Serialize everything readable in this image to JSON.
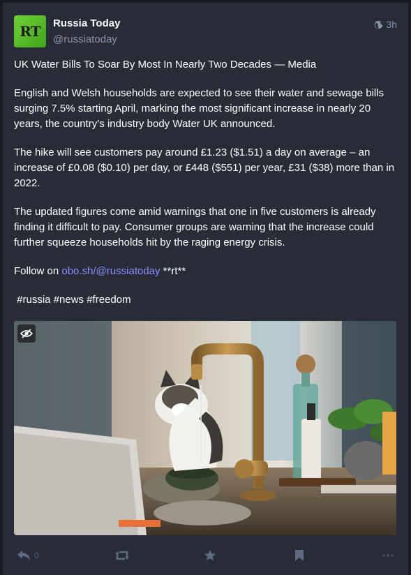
{
  "account": {
    "display_name": "Russia Today",
    "handle": "@russiatoday",
    "avatar_text": "RT"
  },
  "meta": {
    "visibility_icon": "globe-icon",
    "time": "3h"
  },
  "content": {
    "title": "UK Water Bills To Soar By Most In Nearly Two Decades — Media",
    "paragraph_1": "English and Welsh households are expected to see their water and sewage bills surging 7.5% starting April, marking the most significant increase in nearly 20 years, the country’s industry body Water UK announced.",
    "paragraph_2": "The hike will see customers pay around £1.23 ($1.51) a day on average – an increase of £0.08 ($0.10) per day, or £448 ($551) per year, £31 ($38) more than in 2022.",
    "paragraph_3": "The updated figures come amid warnings that one in five customers is already finding it difficult to pay. Consumer groups are warning that the increase could further squeeze households hit by the raging energy crisis.",
    "follow_prefix": "Follow on ",
    "follow_link": "obo.sh/@russiatoday",
    "follow_suffix": " **rt**",
    "hashtags": " #russia #news #freedom"
  },
  "media": {
    "hide_icon": "eye-slash-icon"
  },
  "actions": {
    "reply_icon": "reply-icon",
    "reply_count": "0",
    "boost_icon": "retweet-icon",
    "favourite_icon": "star-icon",
    "bookmark_icon": "bookmark-icon",
    "more_icon": "ellipsis-icon"
  },
  "colors": {
    "background": "#191b22",
    "card": "#282c37",
    "text": "#ffffff",
    "muted": "#8d93ab",
    "link": "#8c8dff",
    "icon": "#606984"
  }
}
